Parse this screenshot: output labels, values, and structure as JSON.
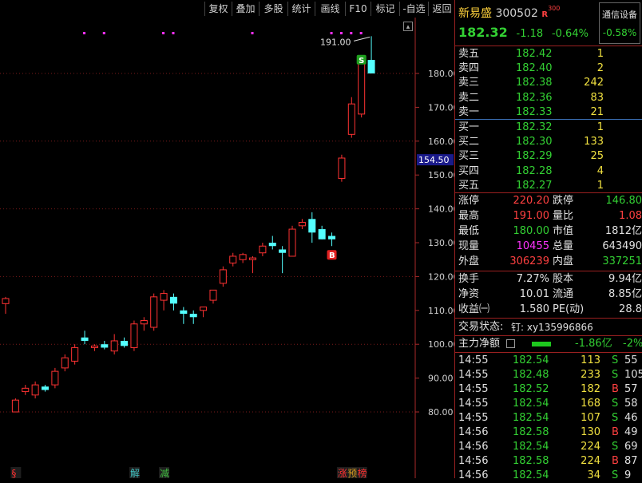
{
  "toolbar": {
    "buttons": [
      "复权",
      "叠加",
      "多股",
      "统计",
      "画线",
      "F10",
      "标记",
      "-自选",
      "返回"
    ]
  },
  "chart_data": {
    "type": "candlestick",
    "y_ticks": [
      80,
      90,
      100,
      110,
      120,
      130,
      140,
      150,
      160,
      170,
      180
    ],
    "y_tick_labels": [
      "80.00",
      "90.00",
      "100.00",
      "110.00",
      "120.00",
      "130.00",
      "140.00",
      "150.00",
      "160.00",
      "170.00",
      "180.00"
    ],
    "ylim": [
      75,
      193
    ],
    "current_price_label": "154.50",
    "current_price_value": 154.5,
    "high_annotation": {
      "label": "191.00",
      "value": 191.0
    },
    "candles": [
      {
        "o": 112,
        "h": 114,
        "l": 109,
        "c": 113.5
      },
      {
        "o": 80,
        "h": 84,
        "l": 80,
        "c": 83.5
      },
      {
        "o": 86,
        "h": 88,
        "l": 85,
        "c": 87
      },
      {
        "o": 85,
        "h": 89,
        "l": 84,
        "c": 88
      },
      {
        "o": 87.5,
        "h": 88,
        "l": 86,
        "c": 86.5
      },
      {
        "o": 88,
        "h": 93,
        "l": 87,
        "c": 92
      },
      {
        "o": 93,
        "h": 97,
        "l": 92,
        "c": 96
      },
      {
        "o": 95,
        "h": 100,
        "l": 94,
        "c": 99
      },
      {
        "o": 102,
        "h": 104,
        "l": 100,
        "c": 101
      },
      {
        "o": 99,
        "h": 100,
        "l": 98,
        "c": 99.5
      },
      {
        "o": 100,
        "h": 101,
        "l": 98.5,
        "c": 99
      },
      {
        "o": 98,
        "h": 103,
        "l": 97,
        "c": 101
      },
      {
        "o": 101,
        "h": 102,
        "l": 99,
        "c": 99.5
      },
      {
        "o": 99,
        "h": 107,
        "l": 98,
        "c": 106
      },
      {
        "o": 106,
        "h": 108,
        "l": 104,
        "c": 107
      },
      {
        "o": 105,
        "h": 115,
        "l": 104,
        "c": 114
      },
      {
        "o": 113,
        "h": 116,
        "l": 110,
        "c": 115
      },
      {
        "o": 114,
        "h": 115,
        "l": 110,
        "c": 112
      },
      {
        "o": 110,
        "h": 111,
        "l": 106,
        "c": 109
      },
      {
        "o": 109,
        "h": 110,
        "l": 106,
        "c": 108
      },
      {
        "o": 110,
        "h": 111,
        "l": 108,
        "c": 111
      },
      {
        "o": 113,
        "h": 116,
        "l": 112,
        "c": 116
      },
      {
        "o": 118,
        "h": 123,
        "l": 117,
        "c": 122
      },
      {
        "o": 124,
        "h": 127,
        "l": 123,
        "c": 126
      },
      {
        "o": 125,
        "h": 127,
        "l": 124,
        "c": 126.5
      },
      {
        "o": 125,
        "h": 126,
        "l": 121,
        "c": 125.5
      },
      {
        "o": 127,
        "h": 130,
        "l": 126,
        "c": 129
      },
      {
        "o": 130,
        "h": 132,
        "l": 128,
        "c": 129
      },
      {
        "o": 128,
        "h": 129,
        "l": 121,
        "c": 127
      },
      {
        "o": 126,
        "h": 135,
        "l": 126,
        "c": 134
      },
      {
        "o": 135,
        "h": 137,
        "l": 134,
        "c": 136
      },
      {
        "o": 137,
        "h": 139,
        "l": 130,
        "c": 133
      },
      {
        "o": 134,
        "h": 135,
        "l": 131,
        "c": 131
      },
      {
        "o": 132,
        "h": 133,
        "l": 129,
        "c": 131
      },
      {
        "o": 149,
        "h": 156,
        "l": 148,
        "c": 155
      },
      {
        "o": 162,
        "h": 173,
        "l": 161,
        "c": 171
      },
      {
        "o": 168,
        "h": 185,
        "l": 167,
        "c": 184
      },
      {
        "o": 184,
        "h": 191,
        "l": 180,
        "c": 180
      }
    ],
    "signal_markers": [
      {
        "label": "S",
        "candle": 36,
        "color": "#1ea01e"
      },
      {
        "label": "B",
        "candle": 33,
        "color": "#e02020"
      }
    ],
    "bottom_labels": [
      {
        "label": "§",
        "candle": 1,
        "color": "#ff3030"
      },
      {
        "label": "解",
        "candle": 13,
        "color": "#40c0c0"
      },
      {
        "label": "减",
        "candle": 16,
        "color": "#40c040"
      },
      {
        "label": "涨",
        "candle": 34,
        "color": "#ff3030"
      },
      {
        "label": "预",
        "candle": 35,
        "color": "#e0a020"
      },
      {
        "label": "榜",
        "candle": 36,
        "color": "#ff3030"
      }
    ],
    "grid": true,
    "up_color": "#ff3232",
    "down_color": "#54ffff"
  },
  "stock": {
    "name": "新易盛",
    "code": "300502",
    "badge": "R",
    "badge2": "300",
    "sector": "通信设备",
    "sector_change": "-0.58%",
    "price": "182.32",
    "change": "-1.18",
    "change_pct": "-0.64%"
  },
  "order_book": {
    "asks": [
      {
        "label": "卖五",
        "price": "182.42",
        "vol": "1"
      },
      {
        "label": "卖四",
        "price": "182.40",
        "vol": "2"
      },
      {
        "label": "卖三",
        "price": "182.38",
        "vol": "242"
      },
      {
        "label": "卖二",
        "price": "182.36",
        "vol": "83"
      },
      {
        "label": "卖一",
        "price": "182.33",
        "vol": "21"
      }
    ],
    "bids": [
      {
        "label": "买一",
        "price": "182.32",
        "vol": "1"
      },
      {
        "label": "买二",
        "price": "182.30",
        "vol": "133"
      },
      {
        "label": "买三",
        "price": "182.29",
        "vol": "25"
      },
      {
        "label": "买四",
        "price": "182.28",
        "vol": "4"
      },
      {
        "label": "买五",
        "price": "182.27",
        "vol": "1"
      }
    ]
  },
  "stats1": [
    {
      "l1": "涨停",
      "v1": "220.20",
      "c1": "red",
      "l2": "跌停",
      "v2": "146.80",
      "c2": "green"
    },
    {
      "l1": "最高",
      "v1": "191.00",
      "c1": "red",
      "l2": "量比",
      "v2": "1.08",
      "c2": "red"
    },
    {
      "l1": "最低",
      "v1": "180.00",
      "c1": "green",
      "l2": "市值",
      "v2": "1812亿",
      "c2": "white"
    },
    {
      "l1": "现量",
      "v1": "10455",
      "c1": "magenta",
      "l2": "总量",
      "v2": "643490",
      "c2": "white"
    },
    {
      "l1": "外盘",
      "v1": "306239",
      "c1": "red",
      "l2": "内盘",
      "v2": "337251",
      "c2": "green"
    }
  ],
  "stats2": [
    {
      "l1": "换手",
      "v1": "7.27%",
      "l2": "股本",
      "v2": "9.94亿"
    },
    {
      "l1": "净资",
      "v1": "10.01",
      "l2": "流通",
      "v2": "8.85亿"
    },
    {
      "l1": "收益㈠",
      "v1": "1.580",
      "l2": "PE(动)",
      "v2": "28.8"
    }
  ],
  "status": {
    "label": "交易状态:",
    "value": "钉: xy135996866"
  },
  "main_flow": {
    "label": "主力净额",
    "value": "-1.86亿",
    "pct": "-2%"
  },
  "trades": [
    {
      "t": "14:55",
      "p": "182.54",
      "v": "113",
      "d": "S",
      "n": "55"
    },
    {
      "t": "14:55",
      "p": "182.48",
      "v": "233",
      "d": "S",
      "n": "105"
    },
    {
      "t": "14:55",
      "p": "182.52",
      "v": "182",
      "d": "B",
      "n": "57"
    },
    {
      "t": "14:55",
      "p": "182.54",
      "v": "168",
      "d": "S",
      "n": "58"
    },
    {
      "t": "14:55",
      "p": "182.54",
      "v": "107",
      "d": "S",
      "n": "46"
    },
    {
      "t": "14:56",
      "p": "182.58",
      "v": "130",
      "d": "B",
      "n": "49"
    },
    {
      "t": "14:56",
      "p": "182.54",
      "v": "224",
      "d": "S",
      "n": "69"
    },
    {
      "t": "14:56",
      "p": "182.58",
      "v": "224",
      "d": "B",
      "n": "87"
    },
    {
      "t": "14:56",
      "p": "182.54",
      "v": "34",
      "d": "S",
      "n": "9"
    }
  ]
}
